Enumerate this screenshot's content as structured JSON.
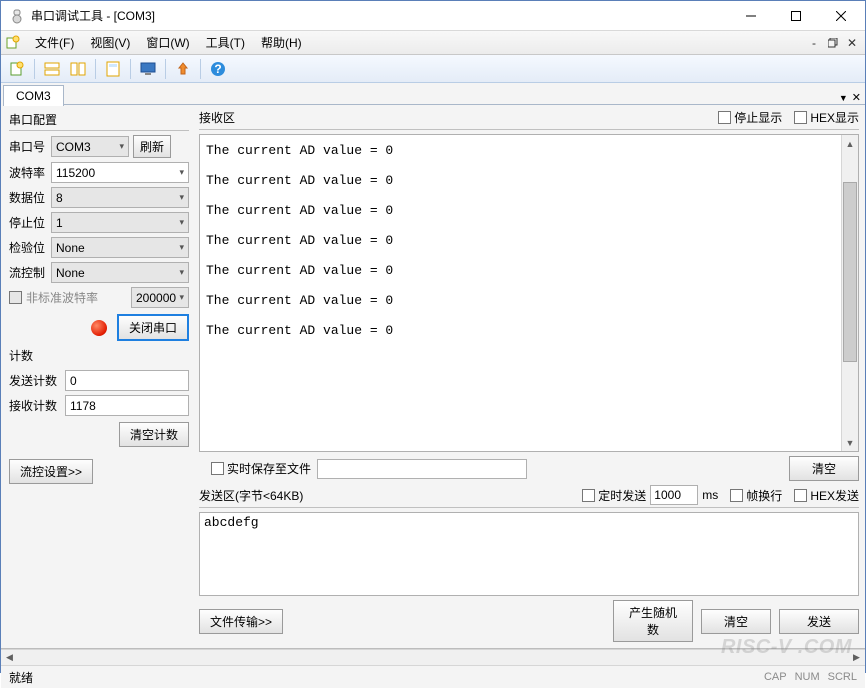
{
  "window": {
    "title": "串口调试工具 - [COM3]"
  },
  "menu": {
    "file": "文件(F)",
    "view": "视图(V)",
    "window": "窗口(W)",
    "tools": "工具(T)",
    "help": "帮助(H)"
  },
  "tab": {
    "name": "COM3"
  },
  "config": {
    "group_title": "串口配置",
    "port_label": "串口号",
    "port_value": "COM3",
    "refresh": "刷新",
    "baud_label": "波特率",
    "baud_value": "115200",
    "databits_label": "数据位",
    "databits_value": "8",
    "stopbits_label": "停止位",
    "stopbits_value": "1",
    "parity_label": "检验位",
    "parity_value": "None",
    "flow_label": "流控制",
    "flow_value": "None",
    "nonstd_label": "非标准波特率",
    "nonstd_value": "200000",
    "close_port": "关闭串口"
  },
  "counters": {
    "group_title": "计数",
    "send_label": "发送计数",
    "send_value": "0",
    "recv_label": "接收计数",
    "recv_value": "1178",
    "clear": "清空计数"
  },
  "flow_settings": "流控设置>>",
  "rx": {
    "title": "接收区",
    "pause": "停止显示",
    "hex": "HEX显示",
    "lines": [
      "The current AD value = 0",
      "",
      "The current AD value = 0",
      "",
      "The current AD value = 0",
      "",
      "The current AD value = 0",
      "",
      "The current AD value = 0",
      "",
      "The current AD value = 0",
      "",
      "The current AD value = 0"
    ]
  },
  "save": {
    "realtime": "实时保存至文件",
    "clear": "清空"
  },
  "tx": {
    "title": "发送区(字节<64KB)",
    "timed": "定时发送",
    "interval": "1000",
    "ms": "ms",
    "wrap": "帧换行",
    "hex": "HEX发送",
    "content": "abcdefg",
    "file_transfer": "文件传输>>",
    "random": "产生随机数",
    "clear": "清空",
    "send": "发送"
  },
  "status": {
    "ready": "就绪",
    "cap": "CAP",
    "num": "NUM",
    "scrl": "SCRL"
  },
  "watermark": "RISC-V .COM"
}
